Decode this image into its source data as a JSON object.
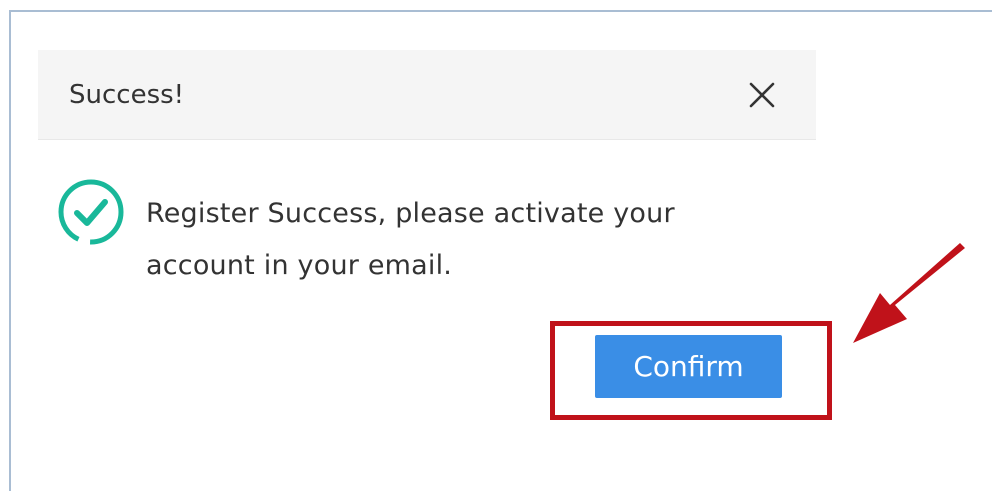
{
  "dialog": {
    "title": "Success!",
    "message": "Register Success, please activate your account in your email.",
    "confirm_label": "Confirm"
  },
  "icons": {
    "close": "close-icon",
    "status": "check-circle-icon",
    "pointer": "arrow-pointer-icon"
  },
  "colors": {
    "accent": "#3a8ee6",
    "success": "#19b89a",
    "highlight": "#c0121a"
  }
}
